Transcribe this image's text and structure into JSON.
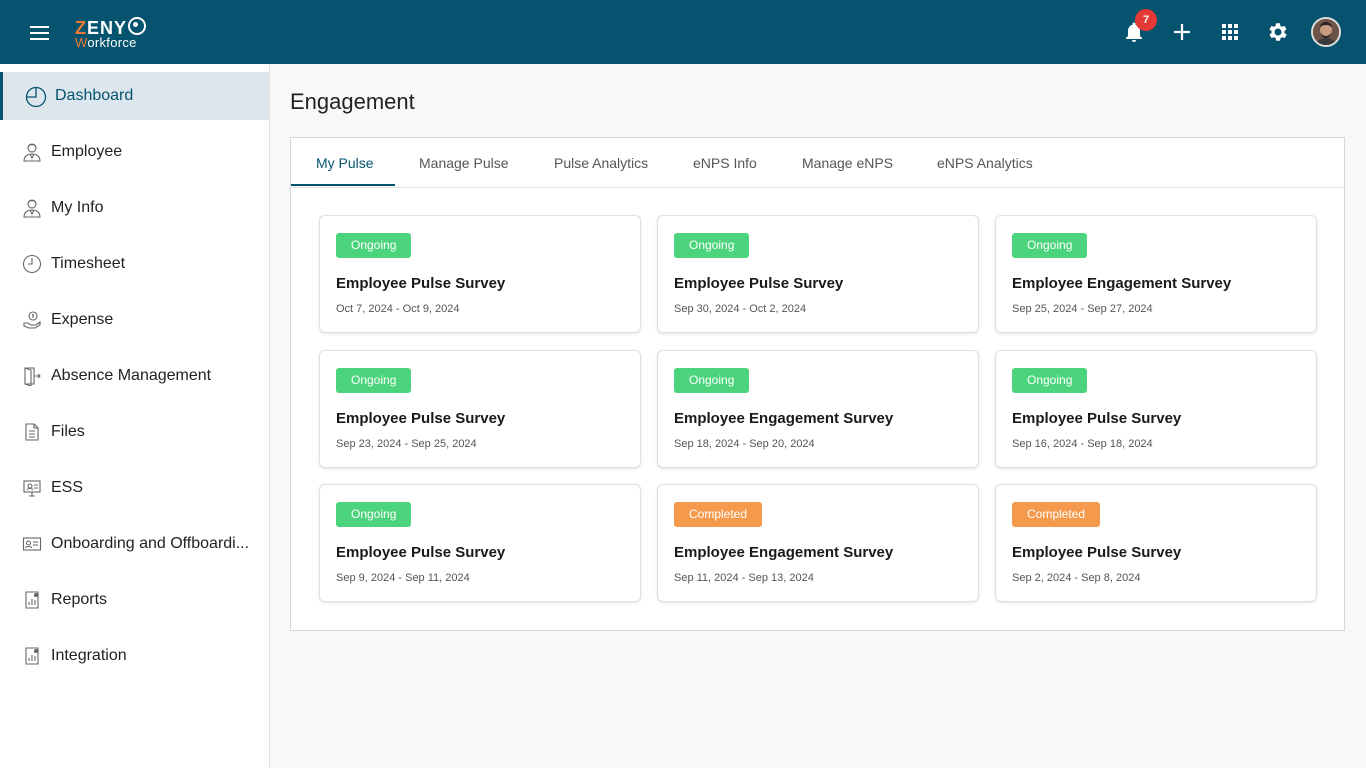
{
  "topbar": {
    "logo_line1_z": "Z",
    "logo_line1_rest": "ENY",
    "logo_line2_w": "W",
    "logo_line2_rest": "orkforce",
    "notification_count": "7",
    "color": "#05536f"
  },
  "sidebar": {
    "items": [
      {
        "label": "Dashboard",
        "icon": "dashboard-icon",
        "active": true
      },
      {
        "label": "Employee",
        "icon": "employee-icon"
      },
      {
        "label": "My Info",
        "icon": "my-info-icon"
      },
      {
        "label": "Timesheet",
        "icon": "clock-icon"
      },
      {
        "label": "Expense",
        "icon": "expense-icon"
      },
      {
        "label": "Absence Management",
        "icon": "door-icon"
      },
      {
        "label": "Files",
        "icon": "file-icon"
      },
      {
        "label": "ESS",
        "icon": "monitor-icon"
      },
      {
        "label": "Onboarding and Offboardi...",
        "icon": "id-card-icon"
      },
      {
        "label": "Reports",
        "icon": "report-icon"
      },
      {
        "label": "Integration",
        "icon": "integration-icon"
      }
    ]
  },
  "main": {
    "title": "Engagement",
    "tabs": [
      {
        "label": "My Pulse",
        "active": true
      },
      {
        "label": "Manage Pulse"
      },
      {
        "label": "Pulse Analytics"
      },
      {
        "label": "eNPS Info"
      },
      {
        "label": "Manage eNPS"
      },
      {
        "label": "eNPS Analytics"
      }
    ],
    "cards": [
      {
        "status": "Ongoing",
        "title": "Employee Pulse Survey",
        "dates": "Oct 7, 2024 - Oct 9, 2024"
      },
      {
        "status": "Ongoing",
        "title": "Employee Pulse Survey",
        "dates": "Sep 30, 2024 - Oct 2, 2024"
      },
      {
        "status": "Ongoing",
        "title": "Employee Engagement Survey",
        "dates": "Sep 25, 2024 - Sep 27, 2024"
      },
      {
        "status": "Ongoing",
        "title": "Employee Pulse Survey",
        "dates": "Sep 23, 2024 - Sep 25, 2024"
      },
      {
        "status": "Ongoing",
        "title": "Employee Engagement Survey",
        "dates": "Sep 18, 2024 - Sep 20, 2024"
      },
      {
        "status": "Ongoing",
        "title": "Employee Pulse Survey",
        "dates": "Sep 16, 2024 - Sep 18, 2024"
      },
      {
        "status": "Ongoing",
        "title": "Employee Pulse Survey",
        "dates": "Sep 9, 2024 - Sep 11, 2024"
      },
      {
        "status": "Completed",
        "title": "Employee Engagement Survey",
        "dates": "Sep 11, 2024 - Sep 13, 2024"
      },
      {
        "status": "Completed",
        "title": "Employee Pulse Survey",
        "dates": "Sep 2, 2024 - Sep 8, 2024"
      }
    ]
  }
}
